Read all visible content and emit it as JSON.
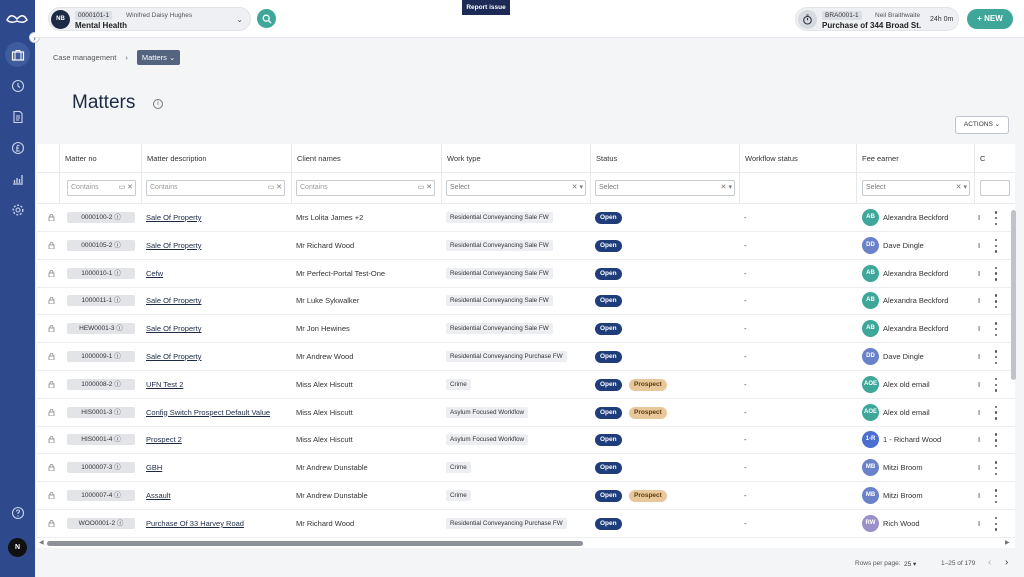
{
  "client": {
    "initials": "NB",
    "code": "0000101-1",
    "name": "Winifred Daisy Hughes",
    "department": "Mental Health"
  },
  "report_label": "Report issue",
  "matter": {
    "code": "BRA0001-1",
    "person": "Neil Braithwaite",
    "title": "Purchase of 344 Broad St.",
    "time": "24h 0m"
  },
  "new_label": "NEW",
  "user_initial": "N",
  "breadcrumb": {
    "root": "Case management",
    "current": "Matters"
  },
  "page_title": "Matters",
  "actions_label": "ACTIONS",
  "columns": [
    "Matter no",
    "Matter description",
    "Client names",
    "Work type",
    "Status",
    "Workflow status",
    "Fee earner",
    "C"
  ],
  "filters": {
    "contains": "Contains",
    "select": "Select"
  },
  "status": {
    "open": "Open",
    "prospect": "Prospect"
  },
  "rows": [
    {
      "no": "0000100-2",
      "desc": "Sale Of Property",
      "client": "Mrs Lolita James +2",
      "work": "Residential Conveyancing Sale FW",
      "prospect": false,
      "wf": "-",
      "fe_init": "AB",
      "fe_color": "#3fa79a",
      "fe_name": "Alexandra Beckford",
      "c": "I"
    },
    {
      "no": "0000105-2",
      "desc": "Sale Of Property",
      "client": "Mr Richard Wood",
      "work": "Residential Conveyancing Sale FW",
      "prospect": false,
      "wf": "-",
      "fe_init": "DD",
      "fe_color": "#6a82c9",
      "fe_name": "Dave Dingle",
      "c": "I"
    },
    {
      "no": "1000010-1",
      "desc": "Cefw",
      "client": "Mr Perfect-Portal Test-One",
      "work": "Residential Conveyancing Sale FW",
      "prospect": false,
      "wf": "-",
      "fe_init": "AB",
      "fe_color": "#3fa79a",
      "fe_name": "Alexandra Beckford",
      "c": "I"
    },
    {
      "no": "1000011-1",
      "desc": "Sale Of Property",
      "client": "Mr Luke Sykwalker",
      "work": "Residential Conveyancing Sale FW",
      "prospect": false,
      "wf": "-",
      "fe_init": "AB",
      "fe_color": "#3fa79a",
      "fe_name": "Alexandra Beckford",
      "c": "I"
    },
    {
      "no": "HEW0001-3",
      "desc": "Sale Of Property",
      "client": "Mr Jon Hewines",
      "work": "Residential Conveyancing Sale FW",
      "prospect": false,
      "wf": "-",
      "fe_init": "AB",
      "fe_color": "#3fa79a",
      "fe_name": "Alexandra Beckford",
      "c": "I"
    },
    {
      "no": "1000009-1",
      "desc": "Sale Of Property",
      "client": "Mr Andrew Wood",
      "work": "Residential Conveyancing Purchase FW",
      "prospect": false,
      "wf": "-",
      "fe_init": "DD",
      "fe_color": "#6a82c9",
      "fe_name": "Dave Dingle",
      "c": "I"
    },
    {
      "no": "1000008-2",
      "desc": "UFN Test 2",
      "client": "Miss Alex Hiscutt",
      "work": "Crime",
      "prospect": true,
      "wf": "-",
      "fe_init": "AOE",
      "fe_color": "#3fa79a",
      "fe_name": "Alex old email",
      "c": "I"
    },
    {
      "no": "HIS0001-3",
      "desc": "Config Switch Prospect Default Value",
      "client": "Miss Alex Hiscutt",
      "work": "Asylum Focused Workflow",
      "prospect": true,
      "wf": "-",
      "fe_init": "AOE",
      "fe_color": "#3fa79a",
      "fe_name": "Alex old email",
      "c": "I"
    },
    {
      "no": "HIS0001-4",
      "desc": "Prospect 2",
      "client": "Miss Alex Hiscutt",
      "work": "Asylum Focused Workflow",
      "prospect": false,
      "wf": "-",
      "fe_init": "1-R",
      "fe_color": "#4a6fd0",
      "fe_name": "1 - Richard Wood",
      "c": "I"
    },
    {
      "no": "1000007-3",
      "desc": "GBH",
      "client": "Mr Andrew Dunstable",
      "work": "Crime",
      "prospect": false,
      "wf": "-",
      "fe_init": "MB",
      "fe_color": "#6a82c9",
      "fe_name": "Mitzi Broom",
      "c": "I"
    },
    {
      "no": "1000007-4",
      "desc": "Assault",
      "client": "Mr Andrew Dunstable",
      "work": "Crime",
      "prospect": true,
      "wf": "-",
      "fe_init": "MB",
      "fe_color": "#6a82c9",
      "fe_name": "Mitzi Broom",
      "c": "I"
    },
    {
      "no": "WOO0001-2",
      "desc": "Purchase Of 33 Harvey Road",
      "client": "Mr Richard Wood",
      "work": "Residential Conveyancing Purchase FW",
      "prospect": false,
      "wf": "-",
      "fe_init": "RW",
      "fe_color": "#9b8fc9",
      "fe_name": "Rich Wood",
      "c": "I"
    }
  ],
  "pagination": {
    "rows_label": "Rows per page:",
    "rows_value": "25",
    "range": "1–25 of 179"
  }
}
